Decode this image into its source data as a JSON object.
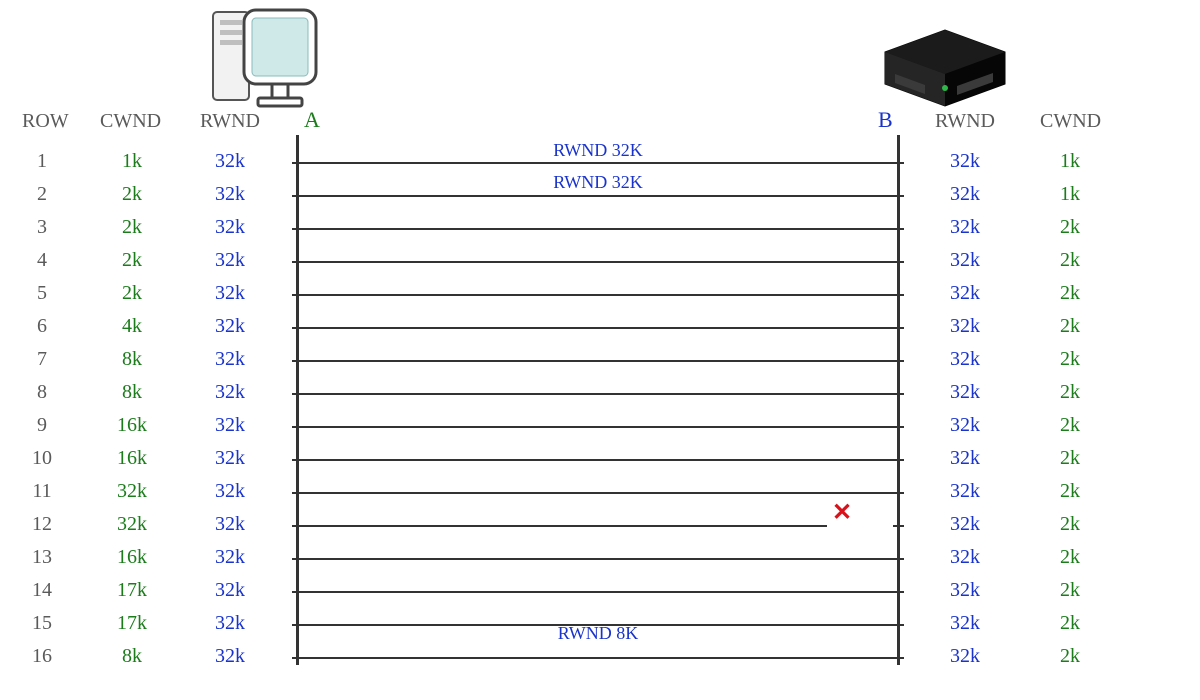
{
  "endpoints": {
    "a_label": "A",
    "b_label": "B"
  },
  "headers": {
    "left": {
      "row": "ROW",
      "cwnd": "CWND",
      "rwnd": "RWND"
    },
    "right": {
      "rwnd": "RWND",
      "cwnd": "CWND"
    }
  },
  "messages": {
    "row1": "RWND 32K",
    "row2": "RWND 32K",
    "row16": "RWND 8K"
  },
  "drop_marker": "✕",
  "rows": [
    {
      "n": "1",
      "lc": "1k",
      "lr": "32k",
      "rr": "32k",
      "rc": "1k"
    },
    {
      "n": "2",
      "lc": "2k",
      "lr": "32k",
      "rr": "32k",
      "rc": "1k"
    },
    {
      "n": "3",
      "lc": "2k",
      "lr": "32k",
      "rr": "32k",
      "rc": "2k"
    },
    {
      "n": "4",
      "lc": "2k",
      "lr": "32k",
      "rr": "32k",
      "rc": "2k"
    },
    {
      "n": "5",
      "lc": "2k",
      "lr": "32k",
      "rr": "32k",
      "rc": "2k"
    },
    {
      "n": "6",
      "lc": "4k",
      "lr": "32k",
      "rr": "32k",
      "rc": "2k"
    },
    {
      "n": "7",
      "lc": "8k",
      "lr": "32k",
      "rr": "32k",
      "rc": "2k"
    },
    {
      "n": "8",
      "lc": "8k",
      "lr": "32k",
      "rr": "32k",
      "rc": "2k"
    },
    {
      "n": "9",
      "lc": "16k",
      "lr": "32k",
      "rr": "32k",
      "rc": "2k"
    },
    {
      "n": "10",
      "lc": "16k",
      "lr": "32k",
      "rr": "32k",
      "rc": "2k"
    },
    {
      "n": "11",
      "lc": "32k",
      "lr": "32k",
      "rr": "32k",
      "rc": "2k"
    },
    {
      "n": "12",
      "lc": "32k",
      "lr": "32k",
      "rr": "32k",
      "rc": "2k"
    },
    {
      "n": "13",
      "lc": "16k",
      "lr": "32k",
      "rr": "32k",
      "rc": "2k"
    },
    {
      "n": "14",
      "lc": "17k",
      "lr": "32k",
      "rr": "32k",
      "rc": "2k"
    },
    {
      "n": "15",
      "lc": "17k",
      "lr": "32k",
      "rr": "32k",
      "rc": "2k"
    },
    {
      "n": "16",
      "lc": "8k",
      "lr": "32k",
      "rr": "32k",
      "rc": "2k"
    }
  ]
}
